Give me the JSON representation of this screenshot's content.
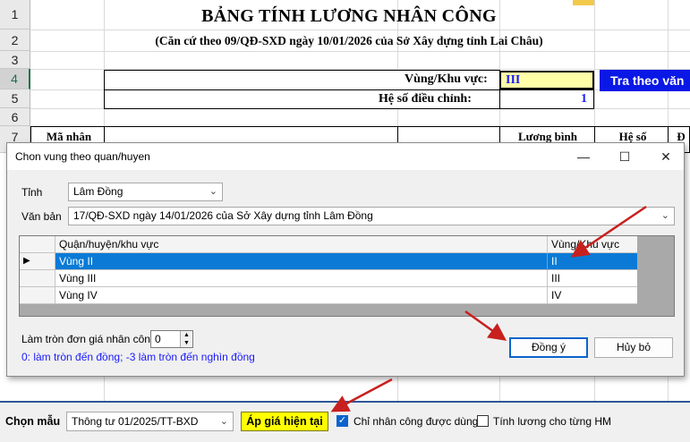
{
  "sheet": {
    "row_numbers": [
      "1",
      "2",
      "3",
      "4",
      "5",
      "6",
      "7"
    ],
    "title": "BẢNG TÍNH LƯƠNG NHÂN CÔNG",
    "subtitle": "(Căn cứ theo 09/QĐ-SXD ngày 10/01/2026 của Sở Xây dựng tỉnh Lai Châu)",
    "region_label": "Vùng/Khu vực:",
    "region_value": "III",
    "adjust_label": "Hệ số điều chỉnh:",
    "adjust_value": "1",
    "lookup_button": "Tra theo văn",
    "col_header_code": "Mã nhân",
    "col_header_salary": "Lương bình",
    "col_header_coef": "Hệ số",
    "col_header_extra": "Đ"
  },
  "dialog": {
    "title": "Chon vung theo quan/huyen",
    "province_label": "Tỉnh",
    "province_value": "Lâm Đồng",
    "document_label": "Văn bản",
    "document_value": "17/QĐ-SXD ngày 14/01/2026 của Sở Xây dựng tỉnh Lâm Đồng",
    "columns": [
      "Quận/huyện/khu vực",
      "Vùng/Khu vực"
    ],
    "rows": [
      {
        "district": "Vùng II",
        "region": "II"
      },
      {
        "district": "Vùng III",
        "region": "III"
      },
      {
        "district": "Vùng IV",
        "region": "IV"
      }
    ],
    "rounding_label": "Làm tròn đơn giá nhân công",
    "rounding_value": "0",
    "rounding_hint": "0: làm tròn đến đồng; -3 làm tròn đến nghìn đồng",
    "ok_label": "Đồng ý",
    "cancel_label": "Hủy bỏ"
  },
  "toolbar": {
    "template_label": "Chọn mẫu",
    "template_value": "Thông tư 01/2025/TT-BXD",
    "apply_price_label": "Áp giá hiện tại",
    "labor_only_label": "Chỉ nhân công được dùng",
    "labor_only_checked": true,
    "per_item_label": "Tính lương cho từng HM",
    "per_item_checked": false
  },
  "colors": {
    "annotation_arrow": "#c8201e",
    "selected_row": "#0a7ad6",
    "lookup_button_bg": "#0a18e6",
    "apply_button_bg": "#ffff00",
    "region_cell_bg": "#ffffa8",
    "hint_text": "#1a1aff"
  },
  "icons": {
    "minimize": "minimize-icon",
    "maximize": "maximize-icon",
    "close": "close-icon",
    "row_pointer": "row-pointer-icon",
    "dropdown": "chevron-down-icon"
  }
}
